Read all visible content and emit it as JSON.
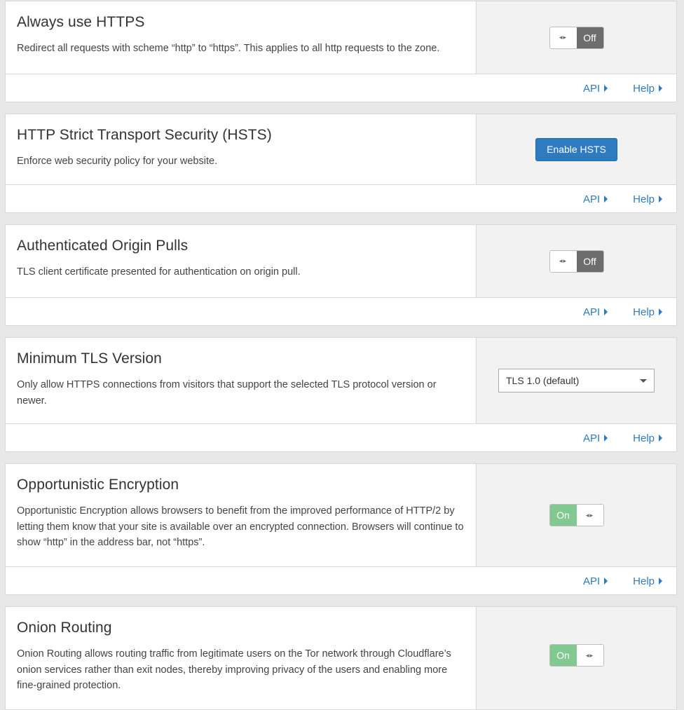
{
  "settings": [
    {
      "title": "Always use HTTPS",
      "description": "Redirect all requests with scheme “http” to “https”. This applies to all http requests to the zone.",
      "control": "toggle",
      "state_label": "Off",
      "api_label": "API",
      "help_label": "Help"
    },
    {
      "title": "HTTP Strict Transport Security (HSTS)",
      "description": "Enforce web security policy for your website.",
      "control": "button",
      "button_label": "Enable HSTS",
      "api_label": "API",
      "help_label": "Help"
    },
    {
      "title": "Authenticated Origin Pulls",
      "description": "TLS client certificate presented for authentication on origin pull.",
      "control": "toggle",
      "state_label": "Off",
      "api_label": "API",
      "help_label": "Help"
    },
    {
      "title": "Minimum TLS Version",
      "description": "Only allow HTTPS connections from visitors that support the selected TLS protocol version or newer.",
      "control": "select",
      "selected_value": "TLS 1.0 (default)",
      "api_label": "API",
      "help_label": "Help"
    },
    {
      "title": "Opportunistic Encryption",
      "description": "Opportunistic Encryption allows browsers to benefit from the improved performance of HTTP/2 by letting them know that your site is available over an encrypted connection. Browsers will continue to show “http” in the address bar, not “https”.",
      "control": "toggle",
      "state_label": "On",
      "api_label": "API",
      "help_label": "Help"
    },
    {
      "title": "Onion Routing",
      "description": "Onion Routing allows routing traffic from legitimate users on the Tor network through Cloudflare’s onion services rather than exit nodes, thereby improving privacy of the users and enabling more fine-grained protection.",
      "control": "toggle",
      "state_label": "On"
    }
  ],
  "toggle_handle_glyph": "◂▸",
  "colors": {
    "link": "#2f7bbf",
    "toggle_off": "#6d6d6d",
    "toggle_on": "#82c891",
    "primary_button": "#2f7bbf",
    "page_bg": "#e8e8e8"
  }
}
